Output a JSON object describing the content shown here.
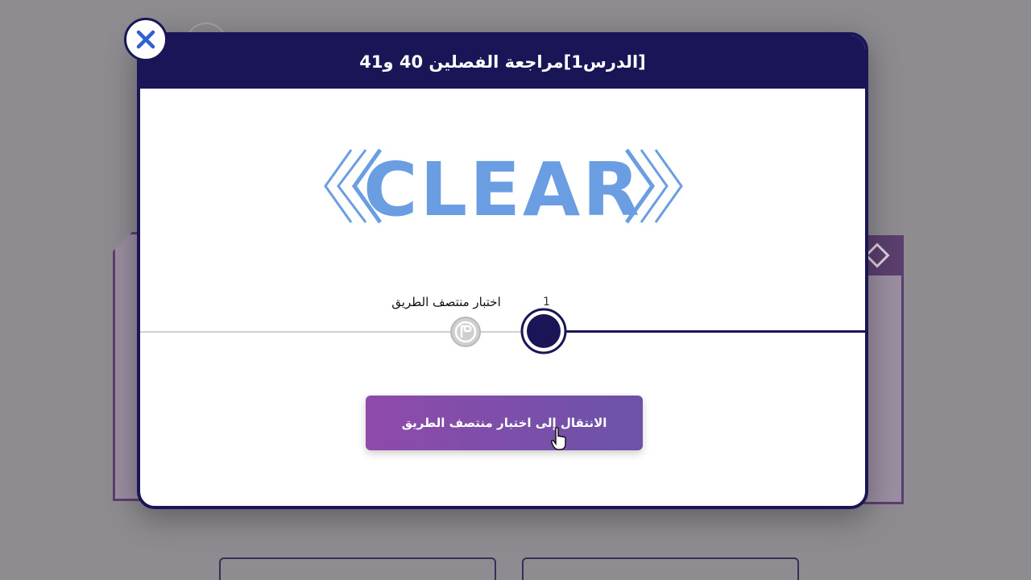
{
  "modal": {
    "title": "[الدرس1]مراجعة الفصلين 40 و41",
    "result_text": "CLEAR",
    "progress": {
      "current_node_number": "1",
      "next_stage_label": "اختبار منتصف الطريق"
    },
    "action_button_label": "الانتقال إلى اختبار منتصف الطريق"
  },
  "icons": {
    "close": "close-icon",
    "flag": "flag-icon",
    "cursor": "hand-pointer-icon"
  },
  "colors": {
    "header": "#191556",
    "accent_text": "#6b9de3",
    "button_start": "#8f4aab",
    "button_end": "#6b53a8"
  }
}
